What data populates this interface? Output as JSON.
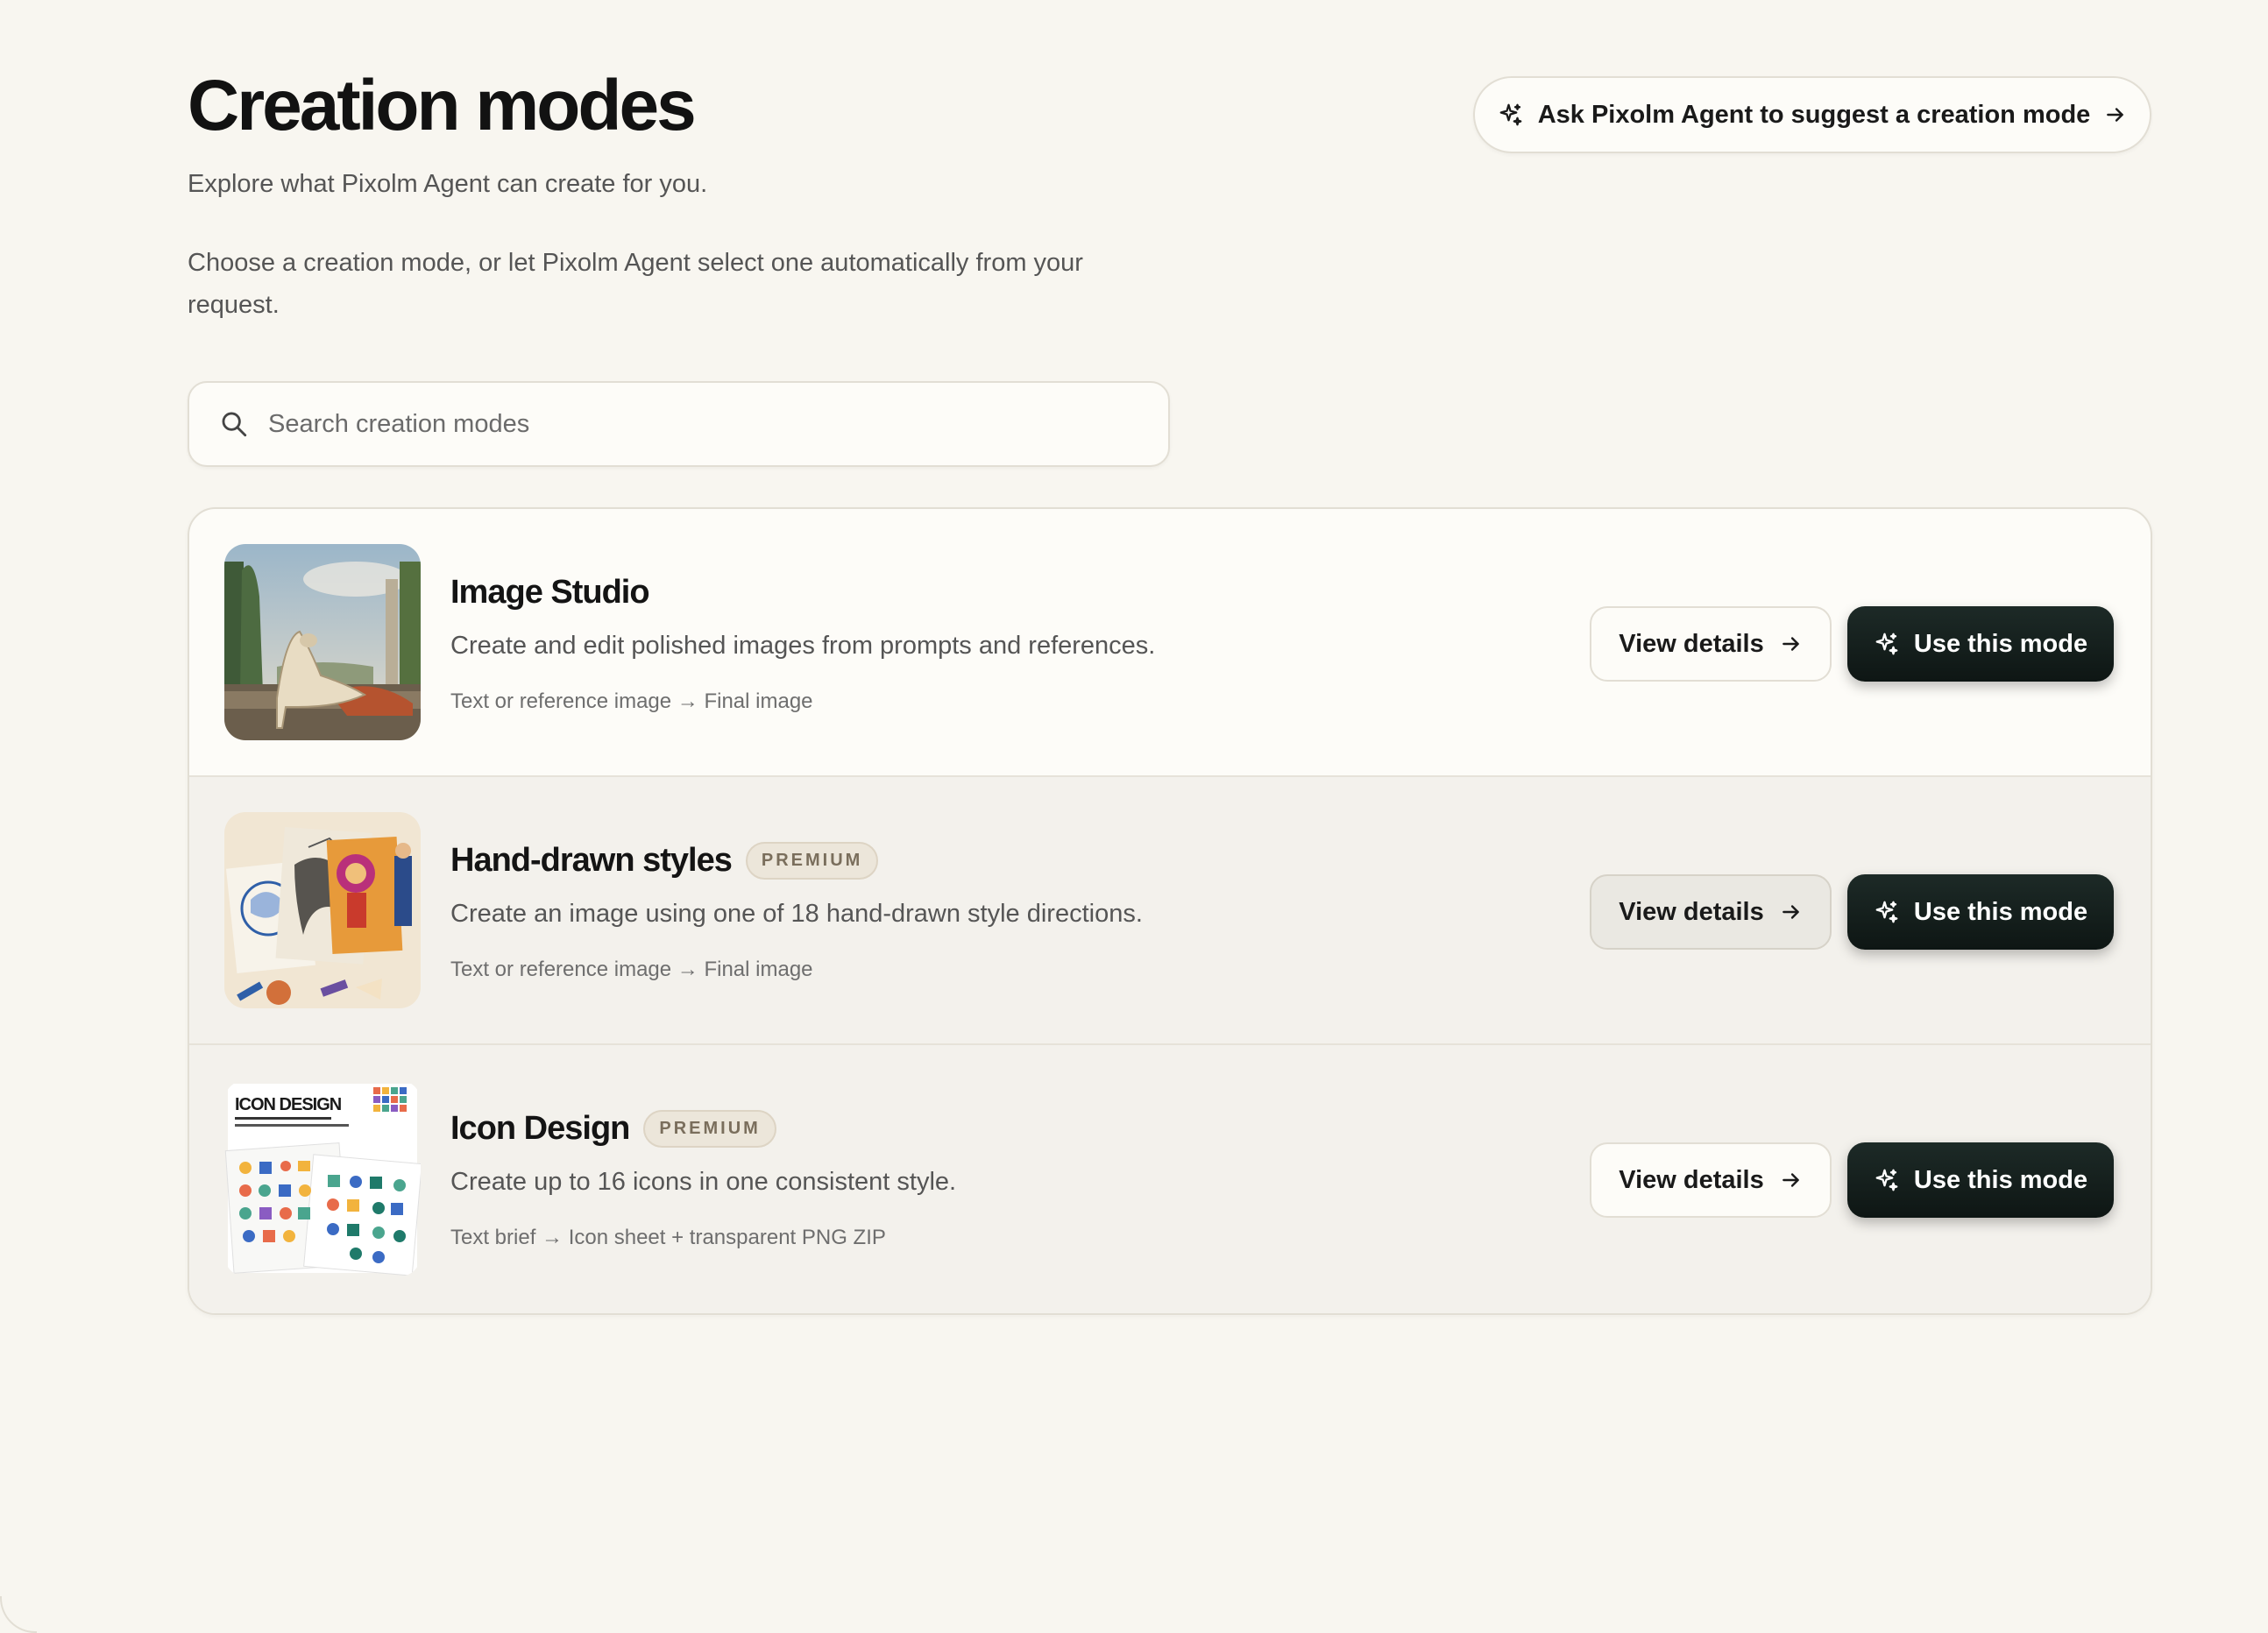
{
  "header": {
    "title": "Creation modes",
    "subtitle": "Explore what Pixolm Agent can create for you.",
    "intro": "Choose a creation mode, or let Pixolm Agent select one automatically from your request.",
    "ask_button_label": "Ask Pixolm Agent to suggest a creation mode"
  },
  "search": {
    "placeholder": "Search creation modes",
    "value": ""
  },
  "modes": [
    {
      "name": "Image Studio",
      "badge": "",
      "description": "Create and edit polished images from prompts and references.",
      "flow": "Text or reference image → Final image",
      "view_label": "View details",
      "use_label": "Use this mode",
      "thumbnail": "high-heel-shoe-on-rock-photo"
    },
    {
      "name": "Hand-drawn styles",
      "badge": "PREMIUM",
      "description": "Create an image using one of 18 hand-drawn style directions.",
      "flow": "Text or reference image → Final image",
      "view_label": "View details",
      "use_label": "Use this mode",
      "thumbnail": "hand-drawn-art-collage"
    },
    {
      "name": "Icon Design",
      "badge": "PREMIUM",
      "description": "Create up to 16 icons in one consistent style.",
      "flow": "Text brief → Icon sheet + transparent PNG ZIP",
      "view_label": "View details",
      "use_label": "Use this mode",
      "thumbnail": "icon-sheet-preview",
      "thumbnail_text": "ICON DESIGN"
    }
  ],
  "colors": {
    "background": "#f8f6f0",
    "primary_button": "#15201d",
    "badge_bg": "#ece6da",
    "badge_text": "#7a6e5c"
  }
}
